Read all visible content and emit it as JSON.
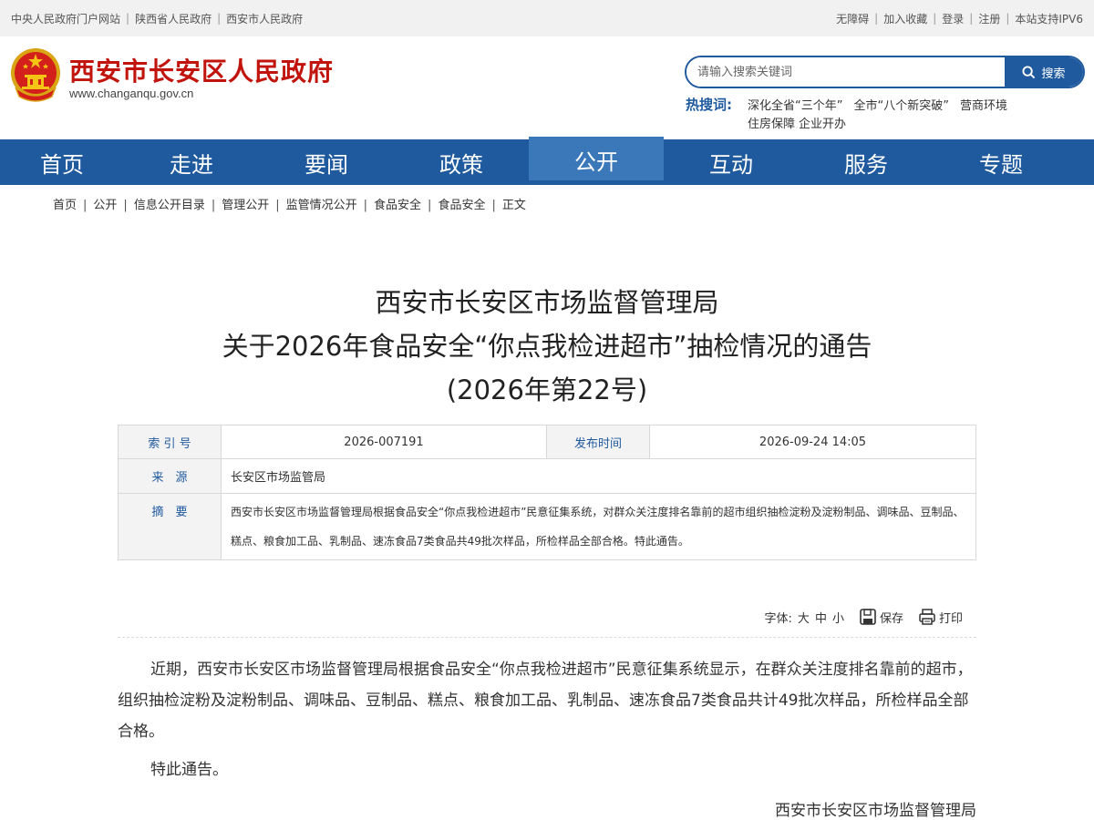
{
  "topbar": {
    "left_links": [
      "中央人民政府门户网站",
      "陕西省人民政府",
      "西安市人民政府"
    ],
    "right_links": [
      "无障碍",
      "加入收藏",
      "登录",
      "注册",
      "本站支持IPV6"
    ]
  },
  "header": {
    "site_title": "西安市长安区人民政府",
    "site_url": "www.changanqu.gov.cn",
    "search_placeholder": "请输入搜索关键词",
    "search_button": "搜索",
    "hot_label": "热搜词:",
    "hot_words": [
      "深化全省“三个年”",
      "全市“八个新突破”",
      "营商环境",
      "住房保障",
      "企业开办"
    ]
  },
  "nav": {
    "items": [
      "首页",
      "走进",
      "要闻",
      "政策",
      "公开",
      "互动",
      "服务",
      "专题"
    ],
    "active": "公开"
  },
  "breadcrumb": [
    "首页",
    "公开",
    "信息公开目录",
    "管理公开",
    "监管情况公开",
    "食品安全",
    "食品安全",
    "正文"
  ],
  "title": {
    "line1": "西安市长安区市场监督管理局",
    "line2": "关于2026年食品安全“你点我检进超市”抽检情况的通告",
    "line3": "(2026年第22号)"
  },
  "meta": {
    "index_label": "索 引 号",
    "index_value": "2026-007191",
    "date_label": "发布时间",
    "date_value": "2026-09-24 14:05",
    "source_label": "来　源",
    "source_value": "长安区市场监管局",
    "abstract_label": "摘　要",
    "abstract_value": "西安市长安区市场监督管理局根据食品安全“你点我检进超市”民意征集系统，对群众关注度排名靠前的超市组织抽检淀粉及淀粉制品、调味品、豆制品、糕点、粮食加工品、乳制品、速冻食品7类食品共49批次样品，所检样品全部合格。特此通告。"
  },
  "tools": {
    "font_label": "字体:",
    "font_large": "大",
    "font_medium": "中",
    "font_small": "小",
    "save": "保存",
    "print": "打印"
  },
  "content": {
    "p1": "近期，西安市长安区市场监督管理局根据食品安全“你点我检进超市”民意征集系统显示，在群众关注度排名靠前的超市，组织抽检淀粉及淀粉制品、调味品、豆制品、糕点、粮食加工品、乳制品、速冻食品7类食品共计49批次样品，所检样品全部合格。",
    "p2": "特此通告。",
    "signature": "西安市长安区市场监督管理局"
  },
  "colors": {
    "brand_blue": "#1f5a9e",
    "nav_active": "#3a78b9",
    "title_red": "#c0140c"
  },
  "icons": [
    "national-emblem-icon",
    "search-icon",
    "save-icon",
    "print-icon"
  ]
}
